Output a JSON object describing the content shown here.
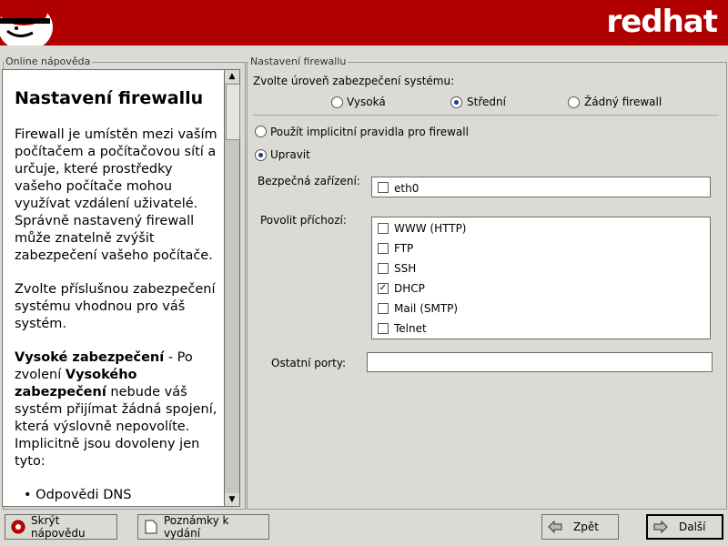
{
  "brand": "redhat",
  "help": {
    "frame_label": "Online nápověda",
    "title": "Nastavení firewallu",
    "paragraphs": [
      "Firewall je umístěn mezi vaším počítačem a počítačovou sítí a určuje, které prostředky vašeho počítače mohou využívat vzdálení uživatelé. Správně nastavený firewall může znatelně zvýšit zabezpečení vašeho počítače.",
      "Zvolte příslušnou zabezpečení systému vhodnou pro váš systém."
    ],
    "high_heading": "Vysoké zabezpečení",
    "high_sep": " - Po zvolení ",
    "high_bold2": "Vysokého zabezpečení",
    "high_rest": " nebude váš systém přijímat žádná spojení, která výslovně nepovolíte. Implicitně jsou dovoleny jen tyto:",
    "bullet": "• Odpovědi DNS"
  },
  "firewall": {
    "frame_label": "Nastavení firewallu",
    "level_prompt": "Zvolte úroveň zabezpečení systému:",
    "levels": [
      {
        "label": "Vysoká",
        "selected": false
      },
      {
        "label": "Střední",
        "selected": true
      },
      {
        "label": "Žádný firewall",
        "selected": false
      }
    ],
    "default_rules_label": "Použít implicitní pravidla pro firewall",
    "default_rules_selected": false,
    "customize_label": "Upravit",
    "customize_selected": true,
    "trusted_label": "Bezpečná zařízení:",
    "trusted_devices": [
      {
        "label": "eth0",
        "checked": false
      }
    ],
    "allow_label": "Povolit příchozí:",
    "services": [
      {
        "label": "WWW (HTTP)",
        "checked": false
      },
      {
        "label": "FTP",
        "checked": false
      },
      {
        "label": "SSH",
        "checked": false
      },
      {
        "label": "DHCP",
        "checked": true
      },
      {
        "label": "Mail (SMTP)",
        "checked": false
      },
      {
        "label": "Telnet",
        "checked": false
      }
    ],
    "other_ports_label": "Ostatní porty:",
    "other_ports_value": ""
  },
  "buttons": {
    "hide_help": "Skrýt nápovědu",
    "release_notes": "Poznámky k vydání",
    "back": "Zpět",
    "next": "Další"
  }
}
